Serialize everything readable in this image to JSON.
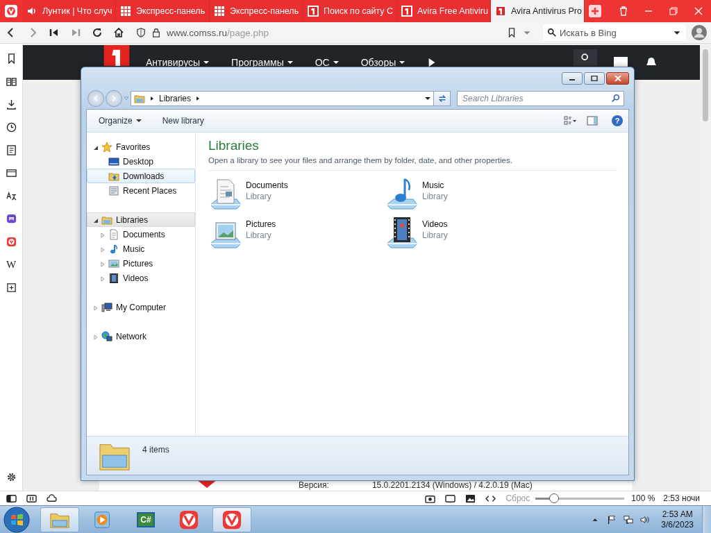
{
  "browser": {
    "tabs": [
      {
        "kind": "speaker",
        "title": "Лунтик | Что случ",
        "selected": false
      },
      {
        "kind": "grid",
        "title": "Экспресс-панель",
        "selected": false
      },
      {
        "kind": "grid",
        "title": "Экспресс-панель",
        "selected": false
      },
      {
        "kind": "site",
        "title": "Поиск по сайту С",
        "selected": false
      },
      {
        "kind": "site",
        "title": "Avira Free Antiviru",
        "selected": false
      },
      {
        "kind": "site",
        "title": "Avira Antivirus Pro",
        "selected": true
      }
    ],
    "address": {
      "domain": "www.comss.ru",
      "path": "/page.php"
    },
    "search": {
      "placeholder": "Искать в Bing"
    },
    "web_panel_glyph": "W"
  },
  "site": {
    "menu": [
      {
        "label": "Антивирусы"
      },
      {
        "label": "Программы"
      },
      {
        "label": "ОС"
      },
      {
        "label": "Обзоры"
      }
    ],
    "info_row": {
      "label": "Версия:",
      "value": "15.0.2201.2134 (Windows) / 4.2.0.19 (Mac)"
    }
  },
  "explorer": {
    "breadcrumb": [
      "Libraries"
    ],
    "search": {
      "placeholder": "Search Libraries"
    },
    "toolbar": [
      {
        "label": "Organize",
        "has_menu": true
      },
      {
        "label": "New library",
        "has_menu": false
      }
    ],
    "help": "?",
    "nav": [
      {
        "label": "Favorites",
        "kind": "star",
        "expanded": true,
        "selected": false,
        "hovered": false,
        "children": [
          {
            "label": "Desktop",
            "kind": "desktop",
            "selected": false,
            "hovered": false
          },
          {
            "label": "Downloads",
            "kind": "downloads",
            "selected": false,
            "hovered": true
          },
          {
            "label": "Recent Places",
            "kind": "recent",
            "selected": false,
            "hovered": false
          }
        ]
      },
      {
        "label": "Libraries",
        "kind": "library",
        "expanded": true,
        "selected": true,
        "hovered": false,
        "children": [
          {
            "label": "Documents",
            "kind": "document",
            "expanded": false,
            "selected": false,
            "hovered": false
          },
          {
            "label": "Music",
            "kind": "music",
            "expanded": false,
            "selected": false,
            "hovered": false
          },
          {
            "label": "Pictures",
            "kind": "picture",
            "expanded": false,
            "selected": false,
            "hovered": false
          },
          {
            "label": "Videos",
            "kind": "video",
            "expanded": false,
            "selected": false,
            "hovered": false
          }
        ]
      },
      {
        "label": "My Computer",
        "kind": "computer",
        "expanded": false,
        "selected": false,
        "hovered": false
      },
      {
        "label": "Network",
        "kind": "network",
        "expanded": false,
        "selected": false,
        "hovered": false
      }
    ],
    "heading": "Libraries",
    "description": "Open a library to see your files and arrange them by folder, date, and other properties.",
    "items": [
      {
        "kind": "document",
        "name": "Documents",
        "type": "Library"
      },
      {
        "kind": "music",
        "name": "Music",
        "type": "Library"
      },
      {
        "kind": "picture",
        "name": "Pictures",
        "type": "Library"
      },
      {
        "kind": "video",
        "name": "Videos",
        "type": "Library"
      }
    ],
    "details": "4 items"
  },
  "status_bar": {
    "reset": "Сброс",
    "zoom": {
      "level": 0.21
    },
    "zoom_text": "100 %",
    "time": "2:53 ночи"
  },
  "taskbar": {
    "apps": [
      {
        "kind": "explorer",
        "selected": true
      },
      {
        "kind": "media",
        "selected": false
      },
      {
        "kind": "code",
        "label": "C#",
        "selected": false
      },
      {
        "kind": "vivaldi",
        "selected": false
      },
      {
        "kind": "vivaldi",
        "selected": true
      }
    ],
    "clock": {
      "time": "2:53 AM",
      "date": "3/6/2023"
    }
  }
}
